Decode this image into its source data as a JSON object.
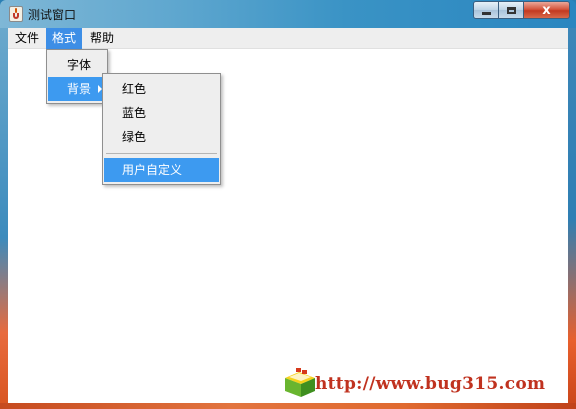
{
  "window": {
    "title": "测试窗口"
  },
  "titlebar": {
    "close_glyph": "x"
  },
  "menubar": {
    "items": [
      "文件",
      "格式",
      "帮助"
    ]
  },
  "format_menu": {
    "items": [
      "字体",
      "背景"
    ]
  },
  "background_submenu": {
    "colors": [
      "红色",
      "蓝色",
      "绿色"
    ],
    "custom": "用户自定义"
  },
  "watermark": {
    "text": "http://www.bug315.com"
  },
  "colors": {
    "menu_highlight": "#3d8ee6",
    "submenu_highlight": "#3d9af0",
    "watermark": "#c0321f"
  }
}
